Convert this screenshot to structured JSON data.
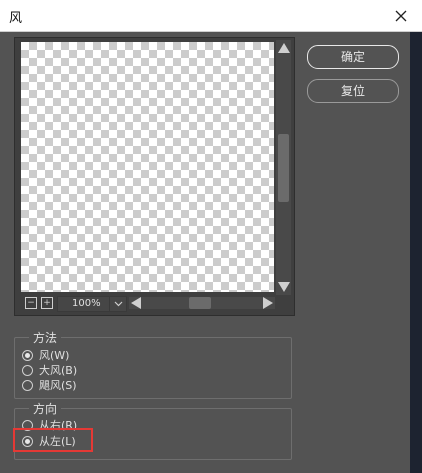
{
  "window": {
    "title": "风"
  },
  "preview": {
    "zoom": "100%"
  },
  "buttons": {
    "ok": "确定",
    "reset": "复位"
  },
  "method": {
    "legend": "方法",
    "options": [
      {
        "label": "风(W)",
        "checked": true
      },
      {
        "label": "大风(B)",
        "checked": false
      },
      {
        "label": "飓风(S)",
        "checked": false
      }
    ]
  },
  "direction": {
    "legend": "方向",
    "options": [
      {
        "label": "从右(R)",
        "checked": false
      },
      {
        "label": "从左(L)",
        "checked": true
      }
    ]
  },
  "colors": {
    "highlight": "#e53935",
    "dialog_bg": "#535353"
  }
}
